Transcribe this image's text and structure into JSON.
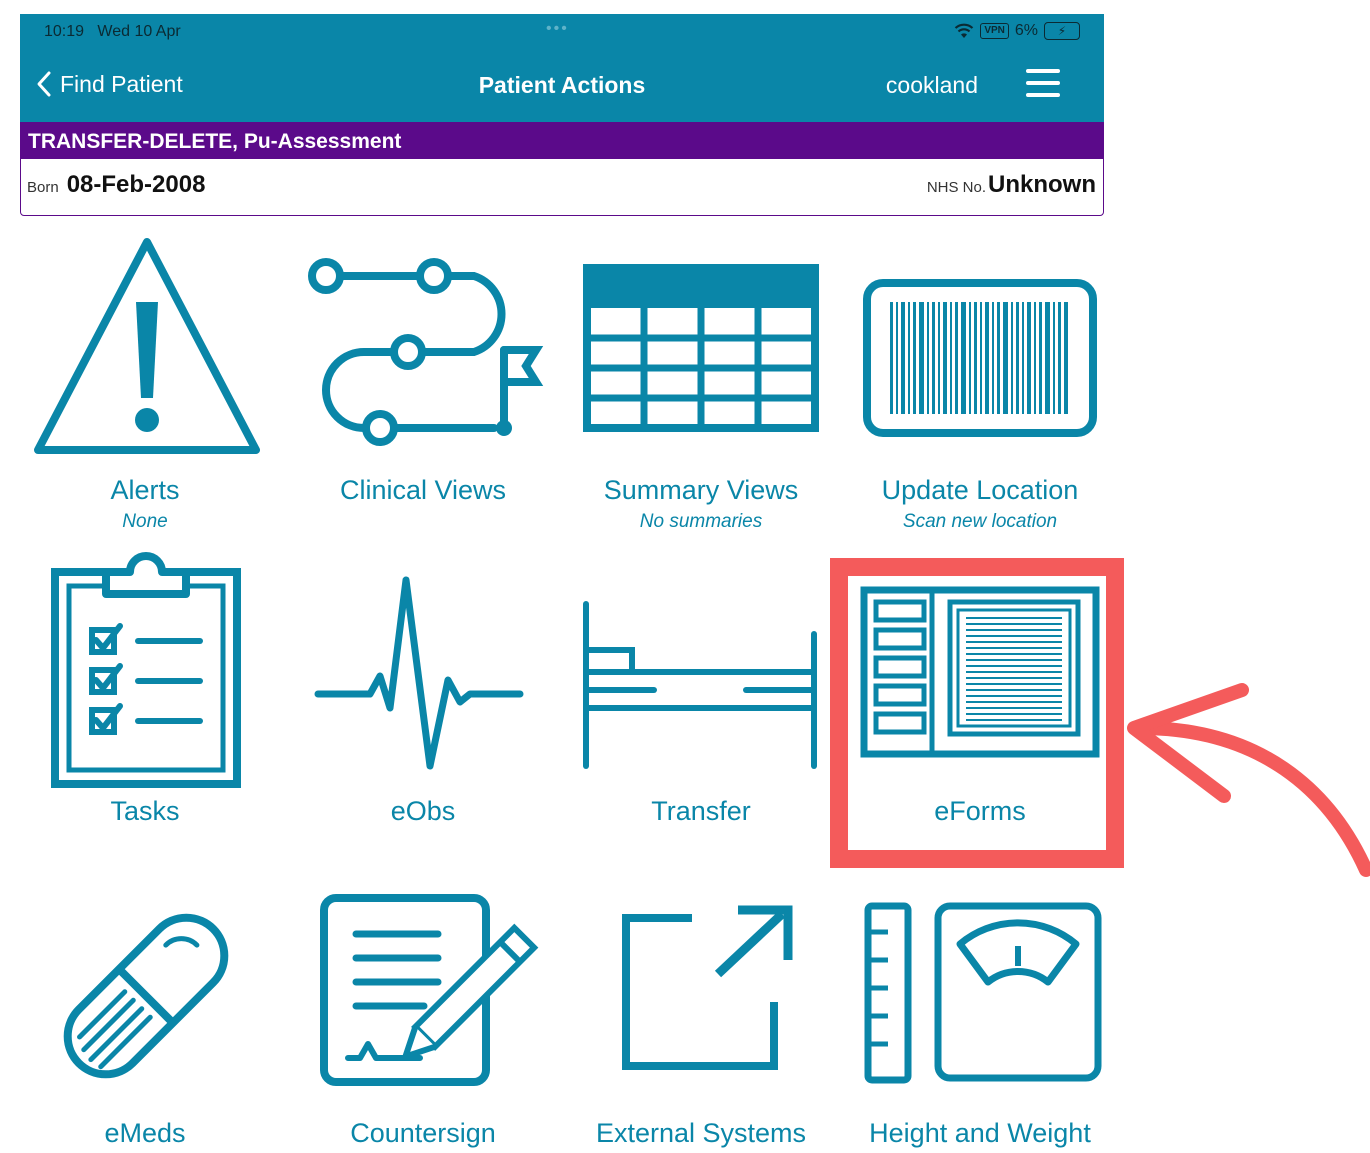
{
  "status_bar": {
    "time": "10:19",
    "date": "Wed 10 Apr",
    "vpn": "VPN",
    "battery": "6%",
    "icons": [
      "wifi-icon",
      "vpn-icon",
      "battery-charging-icon"
    ]
  },
  "nav": {
    "back_label": "Find Patient",
    "title": "Patient Actions",
    "user": "cookland"
  },
  "patient": {
    "name": "TRANSFER-DELETE, Pu-Assessment",
    "born_label": "Born",
    "born_value": "08-Feb-2008",
    "nhs_label": "NHS No.",
    "nhs_value": "Unknown"
  },
  "tiles": [
    {
      "label": "Alerts",
      "sub": "None",
      "icon": "alert-triangle-icon"
    },
    {
      "label": "Clinical Views",
      "sub": "",
      "icon": "pathway-icon"
    },
    {
      "label": "Summary Views",
      "sub": "No summaries",
      "icon": "table-icon"
    },
    {
      "label": "Update Location",
      "sub": "Scan new location",
      "icon": "barcode-icon"
    },
    {
      "label": "Tasks",
      "sub": "",
      "icon": "clipboard-checklist-icon"
    },
    {
      "label": "eObs",
      "sub": "",
      "icon": "heartbeat-icon"
    },
    {
      "label": "Transfer",
      "sub": "",
      "icon": "bed-icon"
    },
    {
      "label": "eForms",
      "sub": "",
      "icon": "form-icon"
    },
    {
      "label": "eMeds",
      "sub": "",
      "icon": "pill-icon"
    },
    {
      "label": "Countersign",
      "sub": "",
      "icon": "document-sign-icon"
    },
    {
      "label": "External Systems",
      "sub": "",
      "icon": "external-link-icon"
    },
    {
      "label": "Height and Weight",
      "sub": "",
      "icon": "scale-ruler-icon"
    }
  ],
  "colors": {
    "primary": "#0a86a8",
    "patient_banner": "#5b0a8a",
    "highlight": "#f45b5b"
  }
}
